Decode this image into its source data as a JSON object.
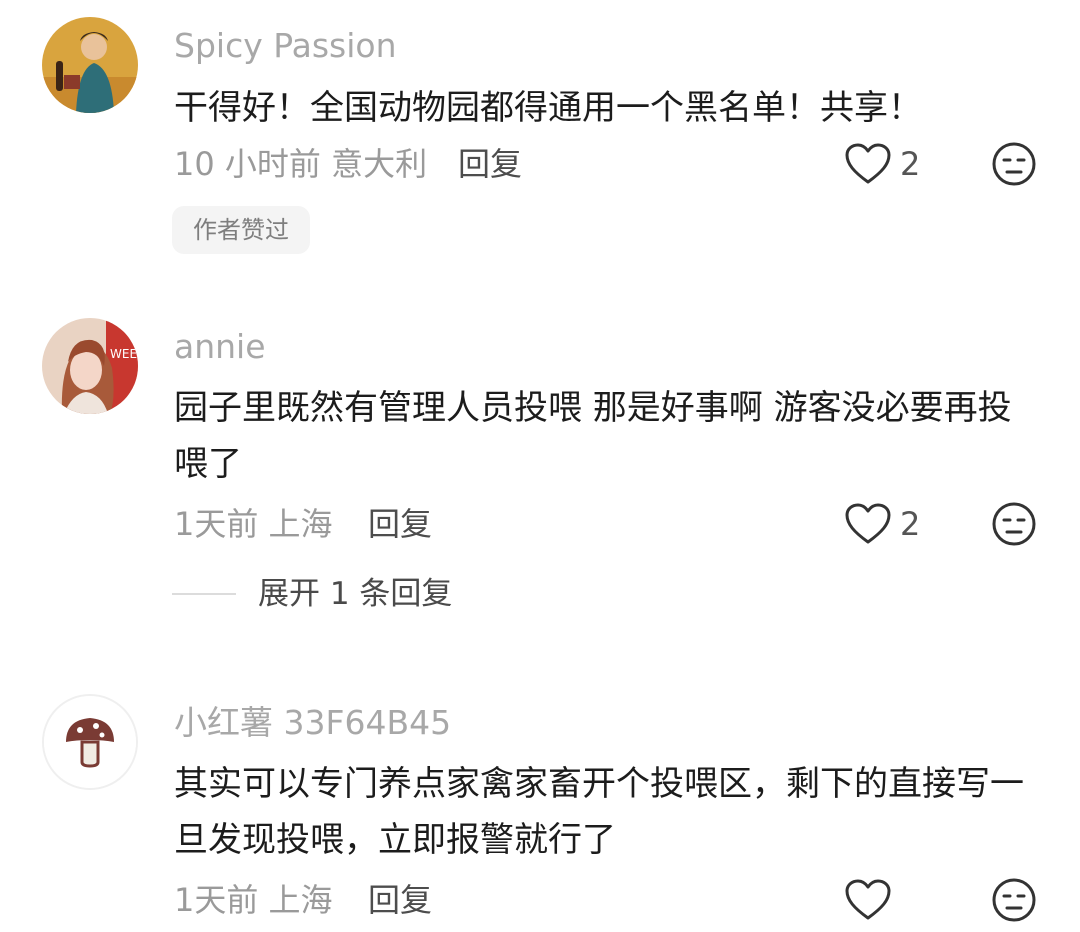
{
  "comments": [
    {
      "username": "Spicy Passion",
      "text": "干得好！全国动物园都得通用一个黑名单！共享！",
      "meta": "10 小时前 意大利",
      "reply": "回复",
      "likes": "2",
      "badge": "作者赞过"
    },
    {
      "username": "annie",
      "text": "园子里既然有管理人员投喂 那是好事啊 游客没必要再投喂了",
      "meta": "1天前 上海",
      "reply": "回复",
      "likes": "2",
      "expand": "展开 1 条回复"
    },
    {
      "username": "小红薯 33F64B45",
      "text": "其实可以专门养点家禽家畜开个投喂区，剩下的直接写一旦发现投喂，立即报警就行了",
      "meta": "1天前 上海",
      "reply": "回复",
      "likes": ""
    }
  ],
  "icons": {
    "like": "heart-outline-icon",
    "dislike": "neutral-face-icon"
  }
}
